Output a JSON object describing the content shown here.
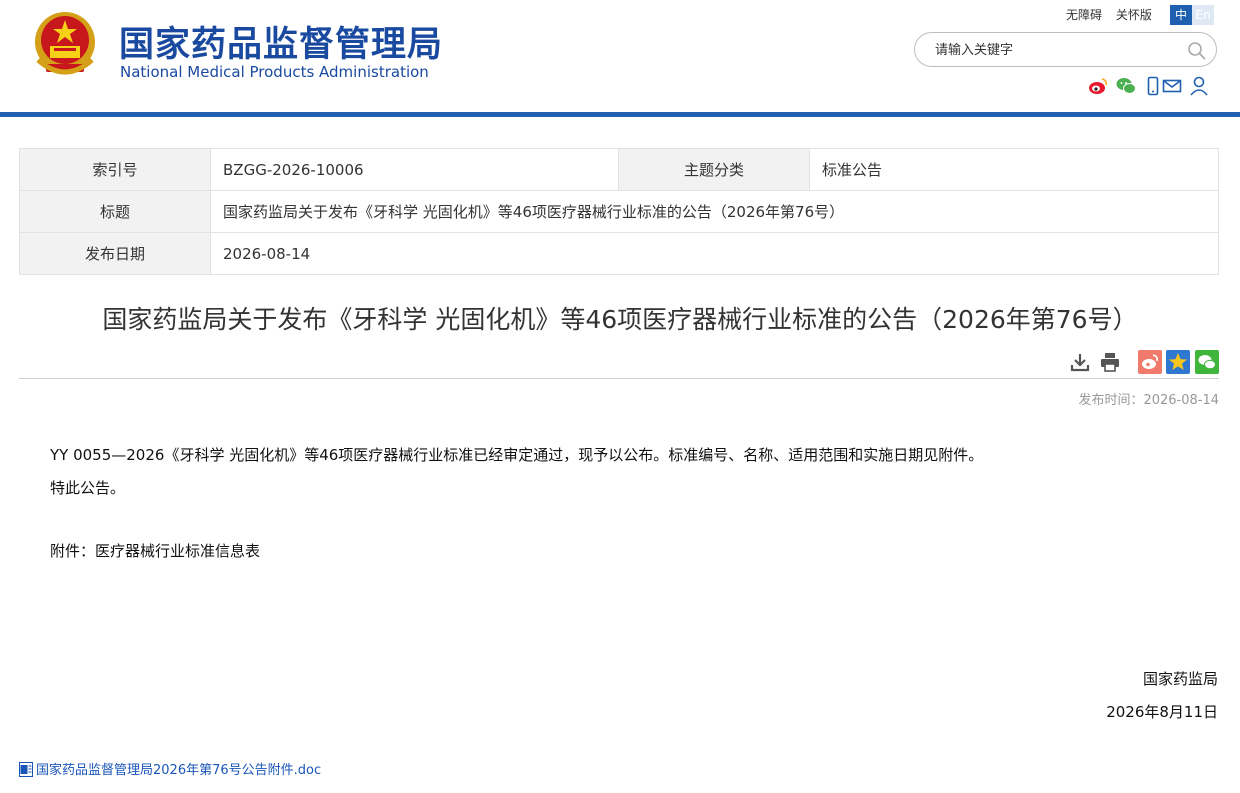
{
  "header": {
    "title_cn": "国家药品监督管理局",
    "title_en": "National Medical Products Administration",
    "top_links": [
      "无障碍",
      "关怀版"
    ],
    "lang_zh": "中",
    "lang_en": "En",
    "search_placeholder": "请输入关键字",
    "social_icons": [
      "weibo-icon",
      "wechat-icon",
      "mobile-icon",
      "mail-icon",
      "user-icon"
    ],
    "accent_color": "#1f5fb0"
  },
  "meta": {
    "index_label": "索引号",
    "index_value": "BZGG-2026-10006",
    "category_label": "主题分类",
    "category_value": "标准公告",
    "title_label": "标题",
    "title_value": "国家药监局关于发布《牙科学 光固化机》等46项医疗器械行业标准的公告（2026年第76号）",
    "date_label": "发布日期",
    "date_value": "2026-08-14"
  },
  "article": {
    "title": "国家药监局关于发布《牙科学 光固化机》等46项医疗器械行业标准的公告（2026年第76号）",
    "tools": [
      "download-icon",
      "print-icon",
      "weibo-share-icon",
      "favorite-icon",
      "wechat-share-icon"
    ],
    "pub_time_label": "发布时间：2026-08-14",
    "paragraph1": "YY 0055—2026《牙科学 光固化机》等46项医疗器械行业标准已经审定通过，现予以公布。标准编号、名称、适用范围和实施日期见附件。",
    "paragraph2": "特此公告。",
    "paragraph3": "附件：医疗器械行业标准信息表",
    "signature_org": "国家药监局",
    "signature_date": "2026年8月11日",
    "attachment_link": "国家药品监督管理局2026年第76号公告附件.doc"
  }
}
